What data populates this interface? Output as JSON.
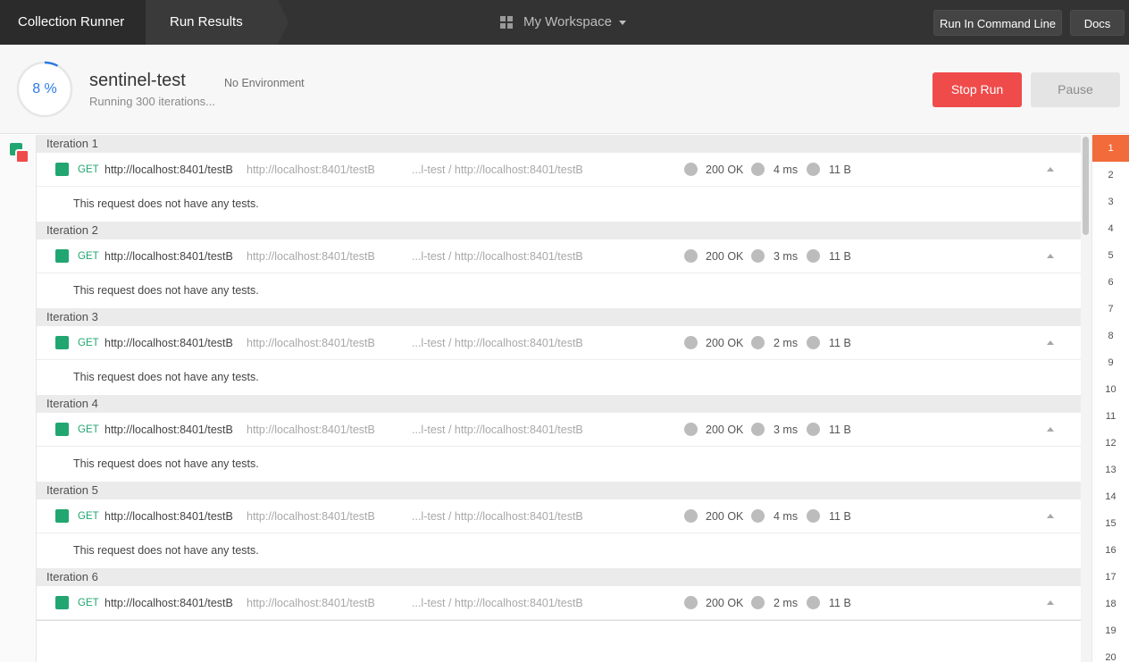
{
  "topbar": {
    "breadcrumb_runner": "Collection Runner",
    "breadcrumb_results": "Run Results",
    "workspace": "My Workspace",
    "command_line_button": "Run In Command Line",
    "docs_button": "Docs"
  },
  "run": {
    "progress_percent": 8,
    "progress_label": "8 %",
    "collection_name": "sentinel-test",
    "status_text": "Running 300 iterations...",
    "environment": "No Environment",
    "stop_button": "Stop Run",
    "pause_button": "Pause"
  },
  "iterations": [
    {
      "label": "Iteration 1",
      "method": "GET",
      "url": "http://localhost:8401/testB",
      "resolved_url": "http://localhost:8401/testB",
      "path": "...l-test / http://localhost:8401/testB",
      "status": "200 OK",
      "time": "4 ms",
      "size": "11 B",
      "test_message": "This request does not have any tests."
    },
    {
      "label": "Iteration 2",
      "method": "GET",
      "url": "http://localhost:8401/testB",
      "resolved_url": "http://localhost:8401/testB",
      "path": "...l-test / http://localhost:8401/testB",
      "status": "200 OK",
      "time": "3 ms",
      "size": "11 B",
      "test_message": "This request does not have any tests."
    },
    {
      "label": "Iteration 3",
      "method": "GET",
      "url": "http://localhost:8401/testB",
      "resolved_url": "http://localhost:8401/testB",
      "path": "...l-test / http://localhost:8401/testB",
      "status": "200 OK",
      "time": "2 ms",
      "size": "11 B",
      "test_message": "This request does not have any tests."
    },
    {
      "label": "Iteration 4",
      "method": "GET",
      "url": "http://localhost:8401/testB",
      "resolved_url": "http://localhost:8401/testB",
      "path": "...l-test / http://localhost:8401/testB",
      "status": "200 OK",
      "time": "3 ms",
      "size": "11 B",
      "test_message": "This request does not have any tests."
    },
    {
      "label": "Iteration 5",
      "method": "GET",
      "url": "http://localhost:8401/testB",
      "resolved_url": "http://localhost:8401/testB",
      "path": "...l-test / http://localhost:8401/testB",
      "status": "200 OK",
      "time": "4 ms",
      "size": "11 B",
      "test_message": "This request does not have any tests."
    },
    {
      "label": "Iteration 6",
      "method": "GET",
      "url": "http://localhost:8401/testB",
      "resolved_url": "http://localhost:8401/testB",
      "path": "...l-test / http://localhost:8401/testB",
      "status": "200 OK",
      "time": "2 ms",
      "size": "11 B",
      "test_message": ""
    }
  ],
  "navigator": {
    "active": "1",
    "items": [
      "1",
      "2",
      "3",
      "4",
      "5",
      "6",
      "7",
      "8",
      "9",
      "10",
      "11",
      "12",
      "13",
      "14",
      "15",
      "16",
      "17",
      "18",
      "19",
      "20"
    ]
  },
  "colors": {
    "topbar": "#333333",
    "accent_blue": "#2c7be5",
    "stop_red": "#ef4b4b",
    "pass_green": "#21a671",
    "active_iteration": "#f26b3a"
  },
  "icons": {
    "workspace": "grid-icon",
    "workspace_caret": "chevron-down-icon",
    "row_collapse": "chevron-up-icon",
    "status": "dot-icon"
  }
}
